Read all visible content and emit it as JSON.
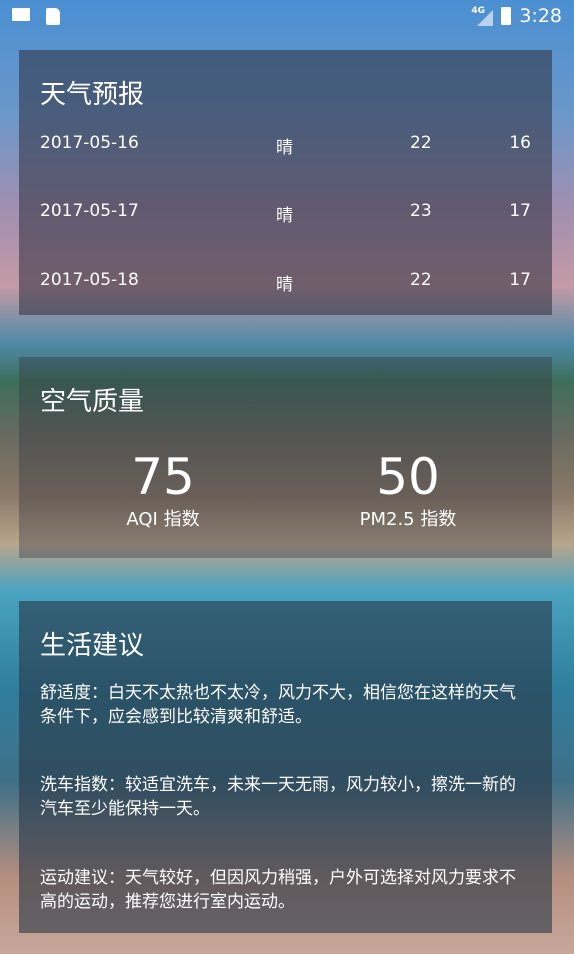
{
  "status_bar": {
    "time": "3:28",
    "network": "4G",
    "left_icons": [
      "mail-icon",
      "sd-card-icon"
    ]
  },
  "forecast": {
    "title": "天气预报",
    "rows": [
      {
        "date": "2017-05-16",
        "weather": "晴",
        "max": "22",
        "min": "16"
      },
      {
        "date": "2017-05-17",
        "weather": "晴",
        "max": "23",
        "min": "17"
      },
      {
        "date": "2017-05-18",
        "weather": "晴",
        "max": "22",
        "min": "17"
      }
    ]
  },
  "aqi": {
    "title": "空气质量",
    "aqi_value": "75",
    "aqi_label": "AQI 指数",
    "pm25_value": "50",
    "pm25_label": "PM2.5 指数"
  },
  "suggestion": {
    "title": "生活建议",
    "comfort": "舒适度：白天不太热也不太冷，风力不大，相信您在这样的天气条件下，应会感到比较清爽和舒适。",
    "car_wash": "洗车指数：较适宜洗车，未来一天无雨，风力较小，擦洗一新的汽车至少能保持一天。",
    "sport": "运动建议：天气较好，但因风力稍强，户外可选择对风力要求不高的运动，推荐您进行室内运动。"
  }
}
